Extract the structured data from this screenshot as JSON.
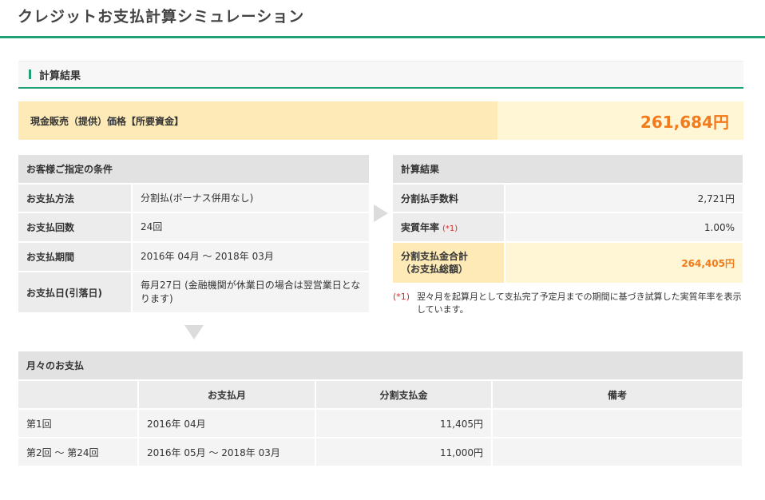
{
  "page": {
    "title": "クレジットお支払計算シミュレーション"
  },
  "section": {
    "title": "計算結果"
  },
  "price": {
    "label": "現金販売（提供）価格【所要資金】",
    "value": "261,684円"
  },
  "conditions": {
    "caption": "お客様ご指定の条件",
    "rows": [
      {
        "label": "お支払方法",
        "value": "分割払(ボーナス併用なし)"
      },
      {
        "label": "お支払回数",
        "value": "24回"
      },
      {
        "label": "お支払期間",
        "value": "2016年 04月 〜 2018年 03月"
      },
      {
        "label": "お支払日(引落日)",
        "value": "毎月27日 (金融機関が休業日の場合は翌営業日となります)"
      }
    ]
  },
  "results": {
    "caption": "計算結果",
    "fee": {
      "label": "分割払手数料",
      "value": "2,721円"
    },
    "rate": {
      "label": "実質年率",
      "ref": "(*1)",
      "value": "1.00%"
    },
    "total": {
      "label_line1": "分割支払金合計",
      "label_line2": "（お支払総額）",
      "value": "264,405円"
    }
  },
  "note": {
    "ref": "(*1)",
    "text": "翌々月を起算月として支払完了予定月までの期間に基づき試算した実質年率を表示しています。"
  },
  "monthly": {
    "caption": "月々のお支払",
    "headers": [
      "",
      "お支払月",
      "分割支払金",
      "備考"
    ],
    "rows": [
      {
        "no": "第1回",
        "month": "2016年 04月",
        "amount": "11,405円",
        "remark": ""
      },
      {
        "no": "第2回 〜 第24回",
        "month": "2016年 05月 〜 2018年 03月",
        "amount": "11,000円",
        "remark": ""
      }
    ]
  },
  "colors": {
    "accent": "#1f9f76",
    "highlight": "#f27a1a",
    "note_red": "#d02a2a",
    "price_bg": "#fdeab7"
  }
}
